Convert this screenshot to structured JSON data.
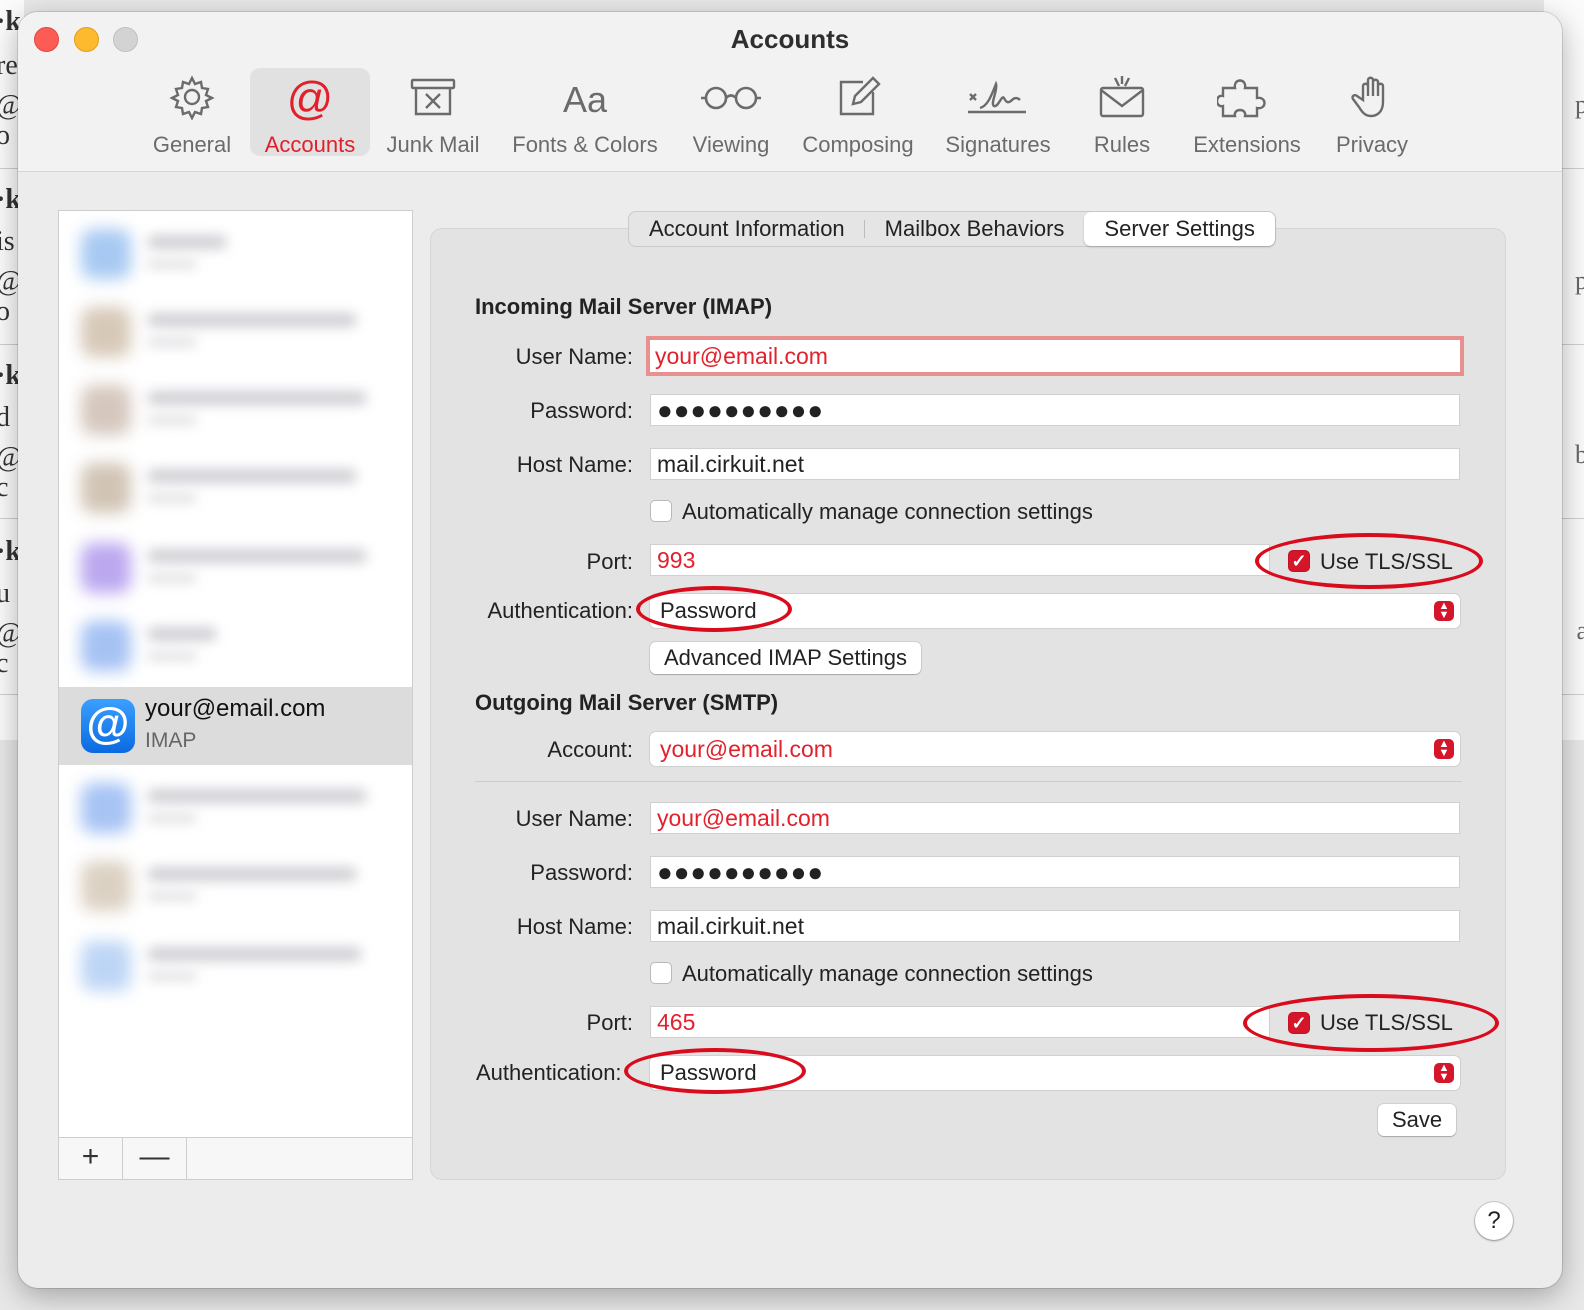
{
  "window": {
    "title": "Accounts"
  },
  "toolbar": {
    "items": [
      {
        "label": "General",
        "icon": "gear-icon"
      },
      {
        "label": "Accounts",
        "icon": "at-icon"
      },
      {
        "label": "Junk Mail",
        "icon": "junk-icon"
      },
      {
        "label": "Fonts & Colors",
        "icon": "fonts-icon"
      },
      {
        "label": "Viewing",
        "icon": "glasses-icon"
      },
      {
        "label": "Composing",
        "icon": "compose-icon"
      },
      {
        "label": "Signatures",
        "icon": "signature-icon"
      },
      {
        "label": "Rules",
        "icon": "rules-icon"
      },
      {
        "label": "Extensions",
        "icon": "puzzle-icon"
      },
      {
        "label": "Privacy",
        "icon": "hand-icon"
      }
    ],
    "active": "Accounts"
  },
  "sidebar": {
    "selected_account": {
      "email": "your@email.com",
      "type": "IMAP"
    },
    "add_label": "+",
    "remove_label": "—"
  },
  "tabs": [
    "Account Information",
    "Mailbox Behaviors",
    "Server Settings"
  ],
  "incoming": {
    "title": "Incoming Mail Server (IMAP)",
    "user_name_label": "User Name:",
    "user_name": "your@email.com",
    "password_label": "Password:",
    "password": "●●●●●●●●●●",
    "host_label": "Host Name:",
    "host": "mail.cirkuit.net",
    "auto_manage_label": "Automatically manage connection settings",
    "port_label": "Port:",
    "port": "993",
    "tls_label": "Use TLS/SSL",
    "auth_label": "Authentication:",
    "auth": "Password",
    "advanced_button": "Advanced IMAP Settings"
  },
  "outgoing": {
    "title": "Outgoing Mail Server (SMTP)",
    "account_label": "Account:",
    "account": "your@email.com",
    "user_name_label": "User Name:",
    "user_name": "your@email.com",
    "password_label": "Password:",
    "password": "●●●●●●●●●●",
    "host_label": "Host Name:",
    "host": "mail.cirkuit.net",
    "auto_manage_label": "Automatically manage connection settings",
    "port_label": "Port:",
    "port": "465",
    "tls_label": "Use TLS/SSL",
    "auth_label": "Authentication:",
    "auth": "Password"
  },
  "save_button": "Save",
  "help_button": "?",
  "colors": {
    "accent": "#e0202a",
    "annotation": "#d90c1d",
    "focus_ring": "#e88f8f"
  }
}
